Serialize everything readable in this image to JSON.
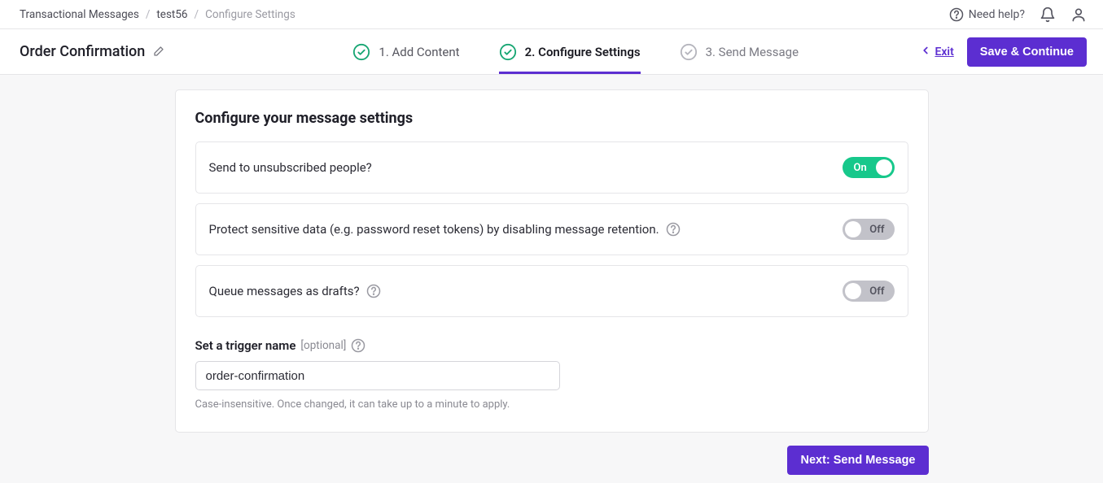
{
  "breadcrumb": {
    "root": "Transactional Messages",
    "parent": "test56",
    "current": "Configure Settings"
  },
  "topbar": {
    "need_help": "Need help?"
  },
  "header": {
    "title": "Order Confirmation",
    "exit": "Exit",
    "save_continue": "Save & Continue"
  },
  "steps": {
    "s1": "1. Add Content",
    "s2": "2. Configure Settings",
    "s3": "3. Send Message"
  },
  "card": {
    "title": "Configure your message settings"
  },
  "settings": {
    "unsubscribed": {
      "label": "Send to unsubscribed people?",
      "state": "On"
    },
    "sensitive": {
      "label": "Protect sensitive data (e.g. password reset tokens) by disabling message retention.",
      "state": "Off"
    },
    "drafts": {
      "label": "Queue messages as drafts?",
      "state": "Off"
    }
  },
  "trigger": {
    "label": "Set a trigger name",
    "optional": "[optional]",
    "value": "order-confirmation",
    "help": "Case-insensitive. Once changed, it can take up to a minute to apply."
  },
  "footer": {
    "next": "Next: Send Message"
  }
}
